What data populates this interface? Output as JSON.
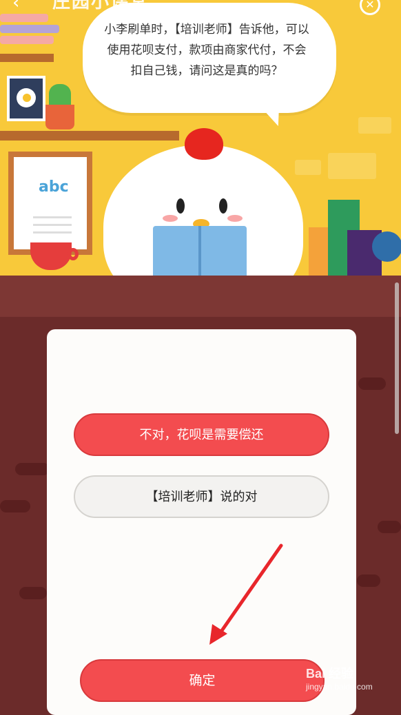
{
  "header": {
    "title": "庄园小课堂"
  },
  "question": {
    "text": "小李刷单时，【培训老师】告诉他，可以使用花呗支付，款项由商家代付，不会扣自己钱，请问这是真的吗？"
  },
  "options": [
    {
      "label": "不对，花呗是需要偿还",
      "selected": true
    },
    {
      "label": "【培训老师】说的对",
      "selected": false
    }
  ],
  "confirm": {
    "label": "确定"
  },
  "illustration": {
    "abc_text": "abc"
  },
  "watermark": {
    "main": "Bai 经验",
    "sub": "jingyan.baidu.com"
  },
  "colors": {
    "accent_red": "#f34c4f",
    "scene_yellow": "#f8c93a",
    "floor_brown": "#6b2b2a"
  },
  "icons": {
    "back": "chevron-left-icon",
    "close": "close-circle-icon",
    "annotation": "red-arrow-icon"
  }
}
